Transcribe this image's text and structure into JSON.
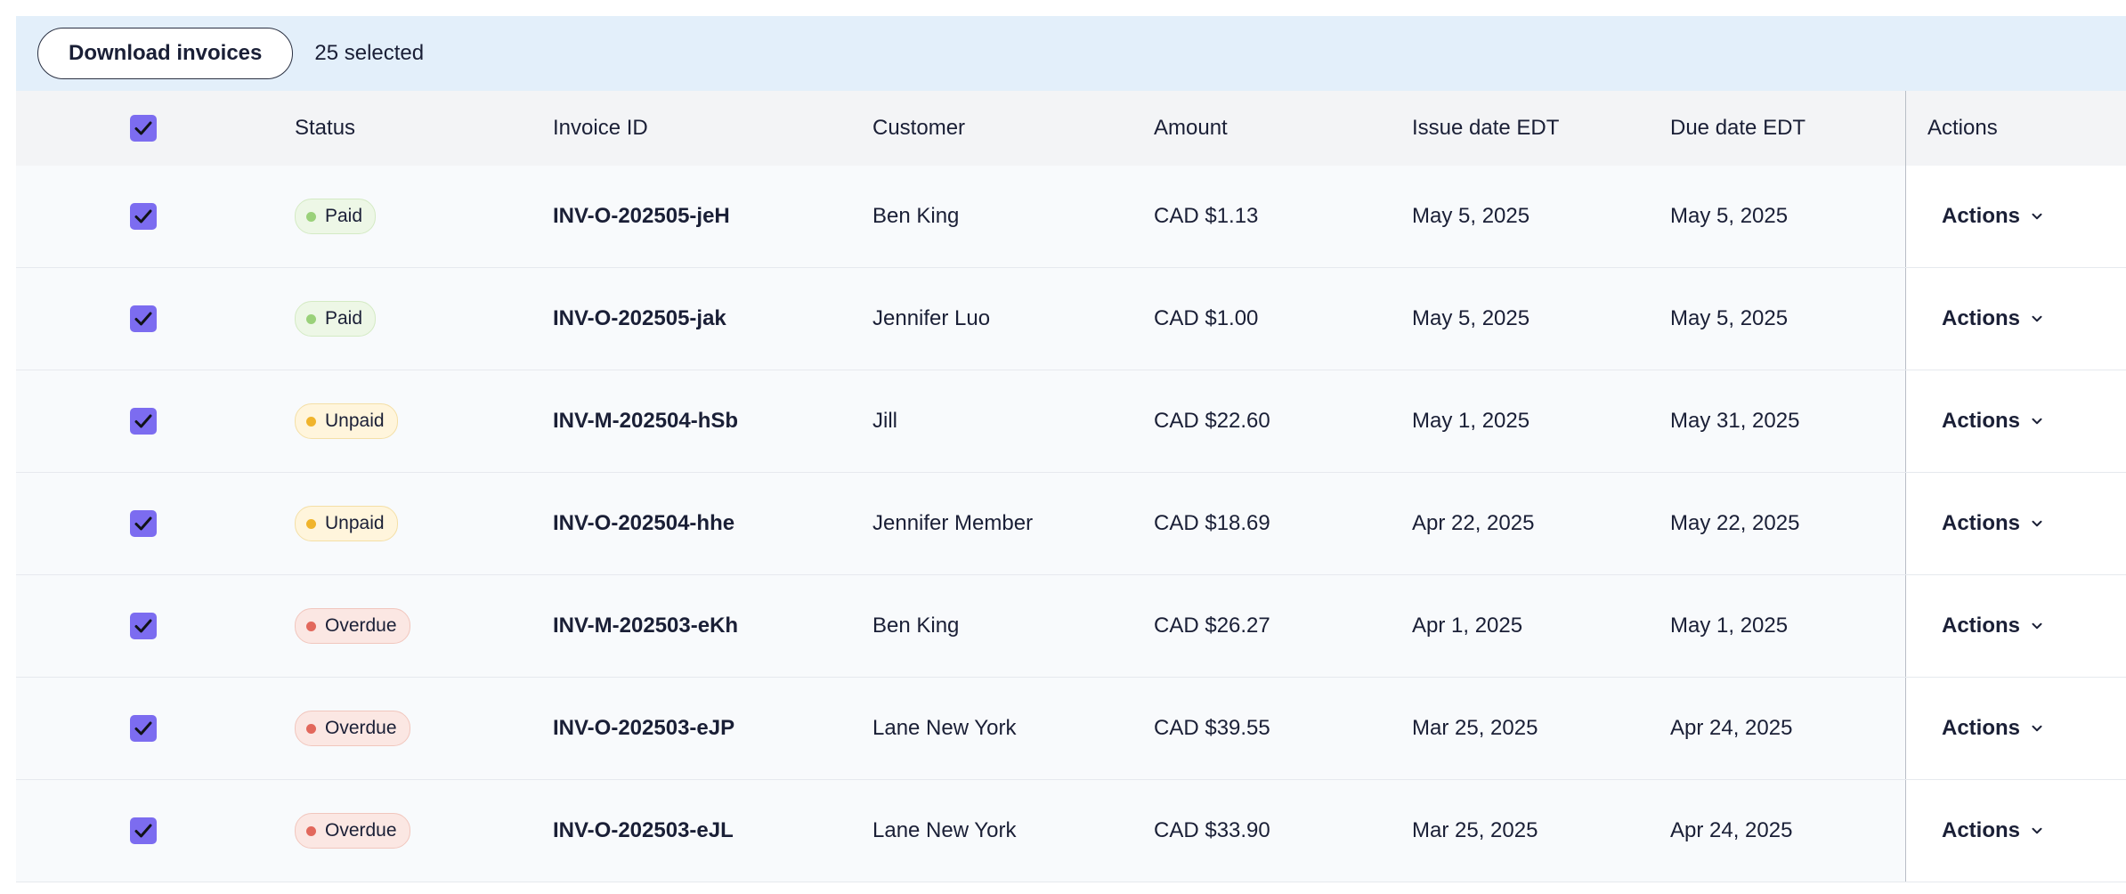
{
  "bulk_bar": {
    "download_label": "Download invoices",
    "selected_text": "25 selected"
  },
  "table": {
    "columns": {
      "status": "Status",
      "invoice_id": "Invoice ID",
      "customer": "Customer",
      "amount": "Amount",
      "issue_date": "Issue date EDT",
      "due_date": "Due date EDT",
      "actions": "Actions"
    },
    "status_styles": {
      "Paid": {
        "bg": "#edf7e6",
        "border": "#d4eac4",
        "dot": "#9ad17a"
      },
      "Unpaid": {
        "bg": "#fff5dc",
        "border": "#f4dfa6",
        "dot": "#f0b42c"
      },
      "Overdue": {
        "bg": "#fbe7e3",
        "border": "#f1c6bd",
        "dot": "#e2685c"
      }
    },
    "rows": [
      {
        "selected": true,
        "status": "Paid",
        "invoice_id": "INV-O-202505-jeH",
        "customer": "Ben King",
        "amount": "CAD $1.13",
        "issue_date": "May 5, 2025",
        "due_date": "May 5, 2025",
        "action_label": "Actions"
      },
      {
        "selected": true,
        "status": "Paid",
        "invoice_id": "INV-O-202505-jak",
        "customer": "Jennifer Luo",
        "amount": "CAD $1.00",
        "issue_date": "May 5, 2025",
        "due_date": "May 5, 2025",
        "action_label": "Actions"
      },
      {
        "selected": true,
        "status": "Unpaid",
        "invoice_id": "INV-M-202504-hSb",
        "customer": "Jill",
        "amount": "CAD $22.60",
        "issue_date": "May 1, 2025",
        "due_date": "May 31, 2025",
        "action_label": "Actions"
      },
      {
        "selected": true,
        "status": "Unpaid",
        "invoice_id": "INV-O-202504-hhe",
        "customer": "Jennifer Member",
        "amount": "CAD $18.69",
        "issue_date": "Apr 22, 2025",
        "due_date": "May 22, 2025",
        "action_label": "Actions"
      },
      {
        "selected": true,
        "status": "Overdue",
        "invoice_id": "INV-M-202503-eKh",
        "customer": "Ben King",
        "amount": "CAD $26.27",
        "issue_date": "Apr 1, 2025",
        "due_date": "May 1, 2025",
        "action_label": "Actions"
      },
      {
        "selected": true,
        "status": "Overdue",
        "invoice_id": "INV-O-202503-eJP",
        "customer": "Lane New York",
        "amount": "CAD $39.55",
        "issue_date": "Mar 25, 2025",
        "due_date": "Apr 24, 2025",
        "action_label": "Actions"
      },
      {
        "selected": true,
        "status": "Overdue",
        "invoice_id": "INV-O-202503-eJL",
        "customer": "Lane New York",
        "amount": "CAD $33.90",
        "issue_date": "Mar 25, 2025",
        "due_date": "Apr 24, 2025",
        "action_label": "Actions"
      }
    ]
  },
  "icons": {
    "checkbox_check": "checkmark-icon",
    "actions_chevron": "chevron-down-icon"
  },
  "colors": {
    "accent_checkbox": "#7c6cf0",
    "bulk_bar_bg": "#e3effa"
  }
}
